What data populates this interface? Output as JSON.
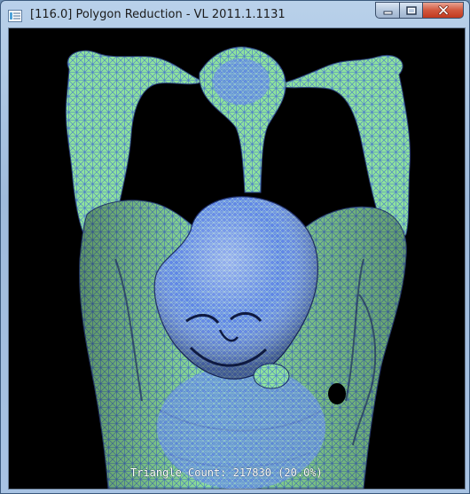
{
  "window": {
    "title": "[116.0] Polygon Reduction - VL 2011.1.1131",
    "icon": "app-window-icon",
    "buttons": {
      "minimize": "minimize-icon",
      "maximize": "maximize-icon",
      "close": "close-icon"
    }
  },
  "viewport": {
    "content": "wireframe-mesh-statue",
    "colors": {
      "background": "#000000",
      "mesh_fill": "#8fe39c",
      "mesh_wire": "#3b63d6"
    }
  },
  "status": {
    "triangle_count_text": "Triangle Count: 217830 (20.0%)"
  }
}
